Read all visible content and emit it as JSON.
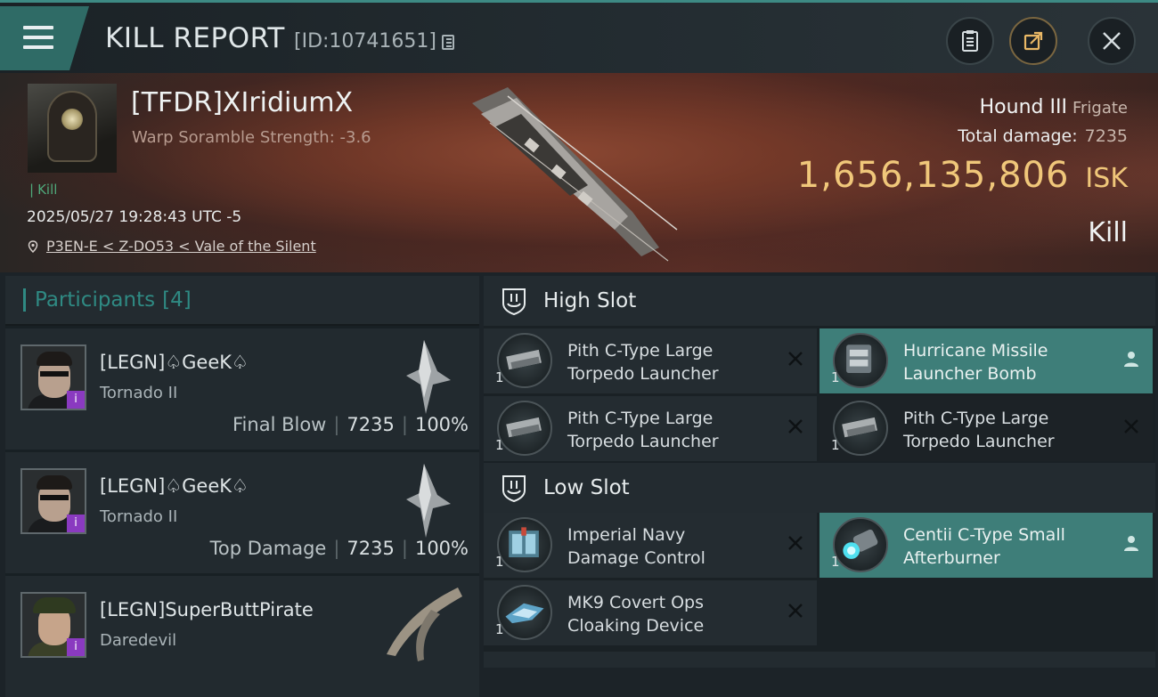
{
  "header": {
    "title": "KILL REPORT",
    "report_id": "[ID:10741651]"
  },
  "victim": {
    "name": "[TFDR]XIridiumX",
    "subtitle": "Warp Soramble Strength: -3.6",
    "tag": "Kill",
    "datetime": "2025/05/27 19:28:43 UTC -5",
    "location": "P3EN-E < Z-DO53 < Vale of the Silent",
    "ship_name": "Hound III",
    "ship_class": "Frigate",
    "total_damage_label": "Total damage:",
    "total_damage": "7235",
    "value": "1,656,135,806",
    "value_unit": "ISK",
    "result": "Kill"
  },
  "participants": {
    "title": "Participants",
    "count": "[4]",
    "items": [
      {
        "name": "[LEGN]♤GeeK♤",
        "ship": "Tornado II",
        "label": "Final Blow",
        "damage": "7235",
        "percent": "100%"
      },
      {
        "name": "[LEGN]♤GeeK♤",
        "ship": "Tornado II",
        "label": "Top Damage",
        "damage": "7235",
        "percent": "100%"
      },
      {
        "name": "[LEGN]SuperButtPirate",
        "ship": "Daredevil"
      }
    ]
  },
  "fitting": {
    "high_slot": {
      "title": "High Slot",
      "modules": [
        {
          "line1": "Pith C-Type Large",
          "line2": "Torpedo Launcher",
          "qty": "1"
        },
        {
          "line1": "Hurricane Missile",
          "line2": "Launcher Bomb",
          "qty": "1"
        },
        {
          "line1": "Pith C-Type Large",
          "line2": "Torpedo Launcher",
          "qty": "1"
        },
        {
          "line1": "Pith C-Type Large",
          "line2": "Torpedo Launcher",
          "qty": "1"
        }
      ]
    },
    "low_slot": {
      "title": "Low Slot",
      "modules": [
        {
          "line1": "Imperial Navy",
          "line2": "Damage Control",
          "qty": "1"
        },
        {
          "line1": "Centii C-Type Small",
          "line2": "Afterburner",
          "qty": "1"
        },
        {
          "line1": "MK9 Covert Ops",
          "line2": "Cloaking Device",
          "qty": "1"
        }
      ]
    }
  },
  "colors": {
    "accent": "#2f8a83",
    "isk": "#f0c77a",
    "highlight_row": "#3e7e79"
  },
  "icons": [
    "menu-icon",
    "copy-icon",
    "clipboard-icon",
    "share-icon",
    "close-icon",
    "location-pin-icon",
    "slot-shield-icon",
    "remove-x-icon",
    "person-icon"
  ]
}
